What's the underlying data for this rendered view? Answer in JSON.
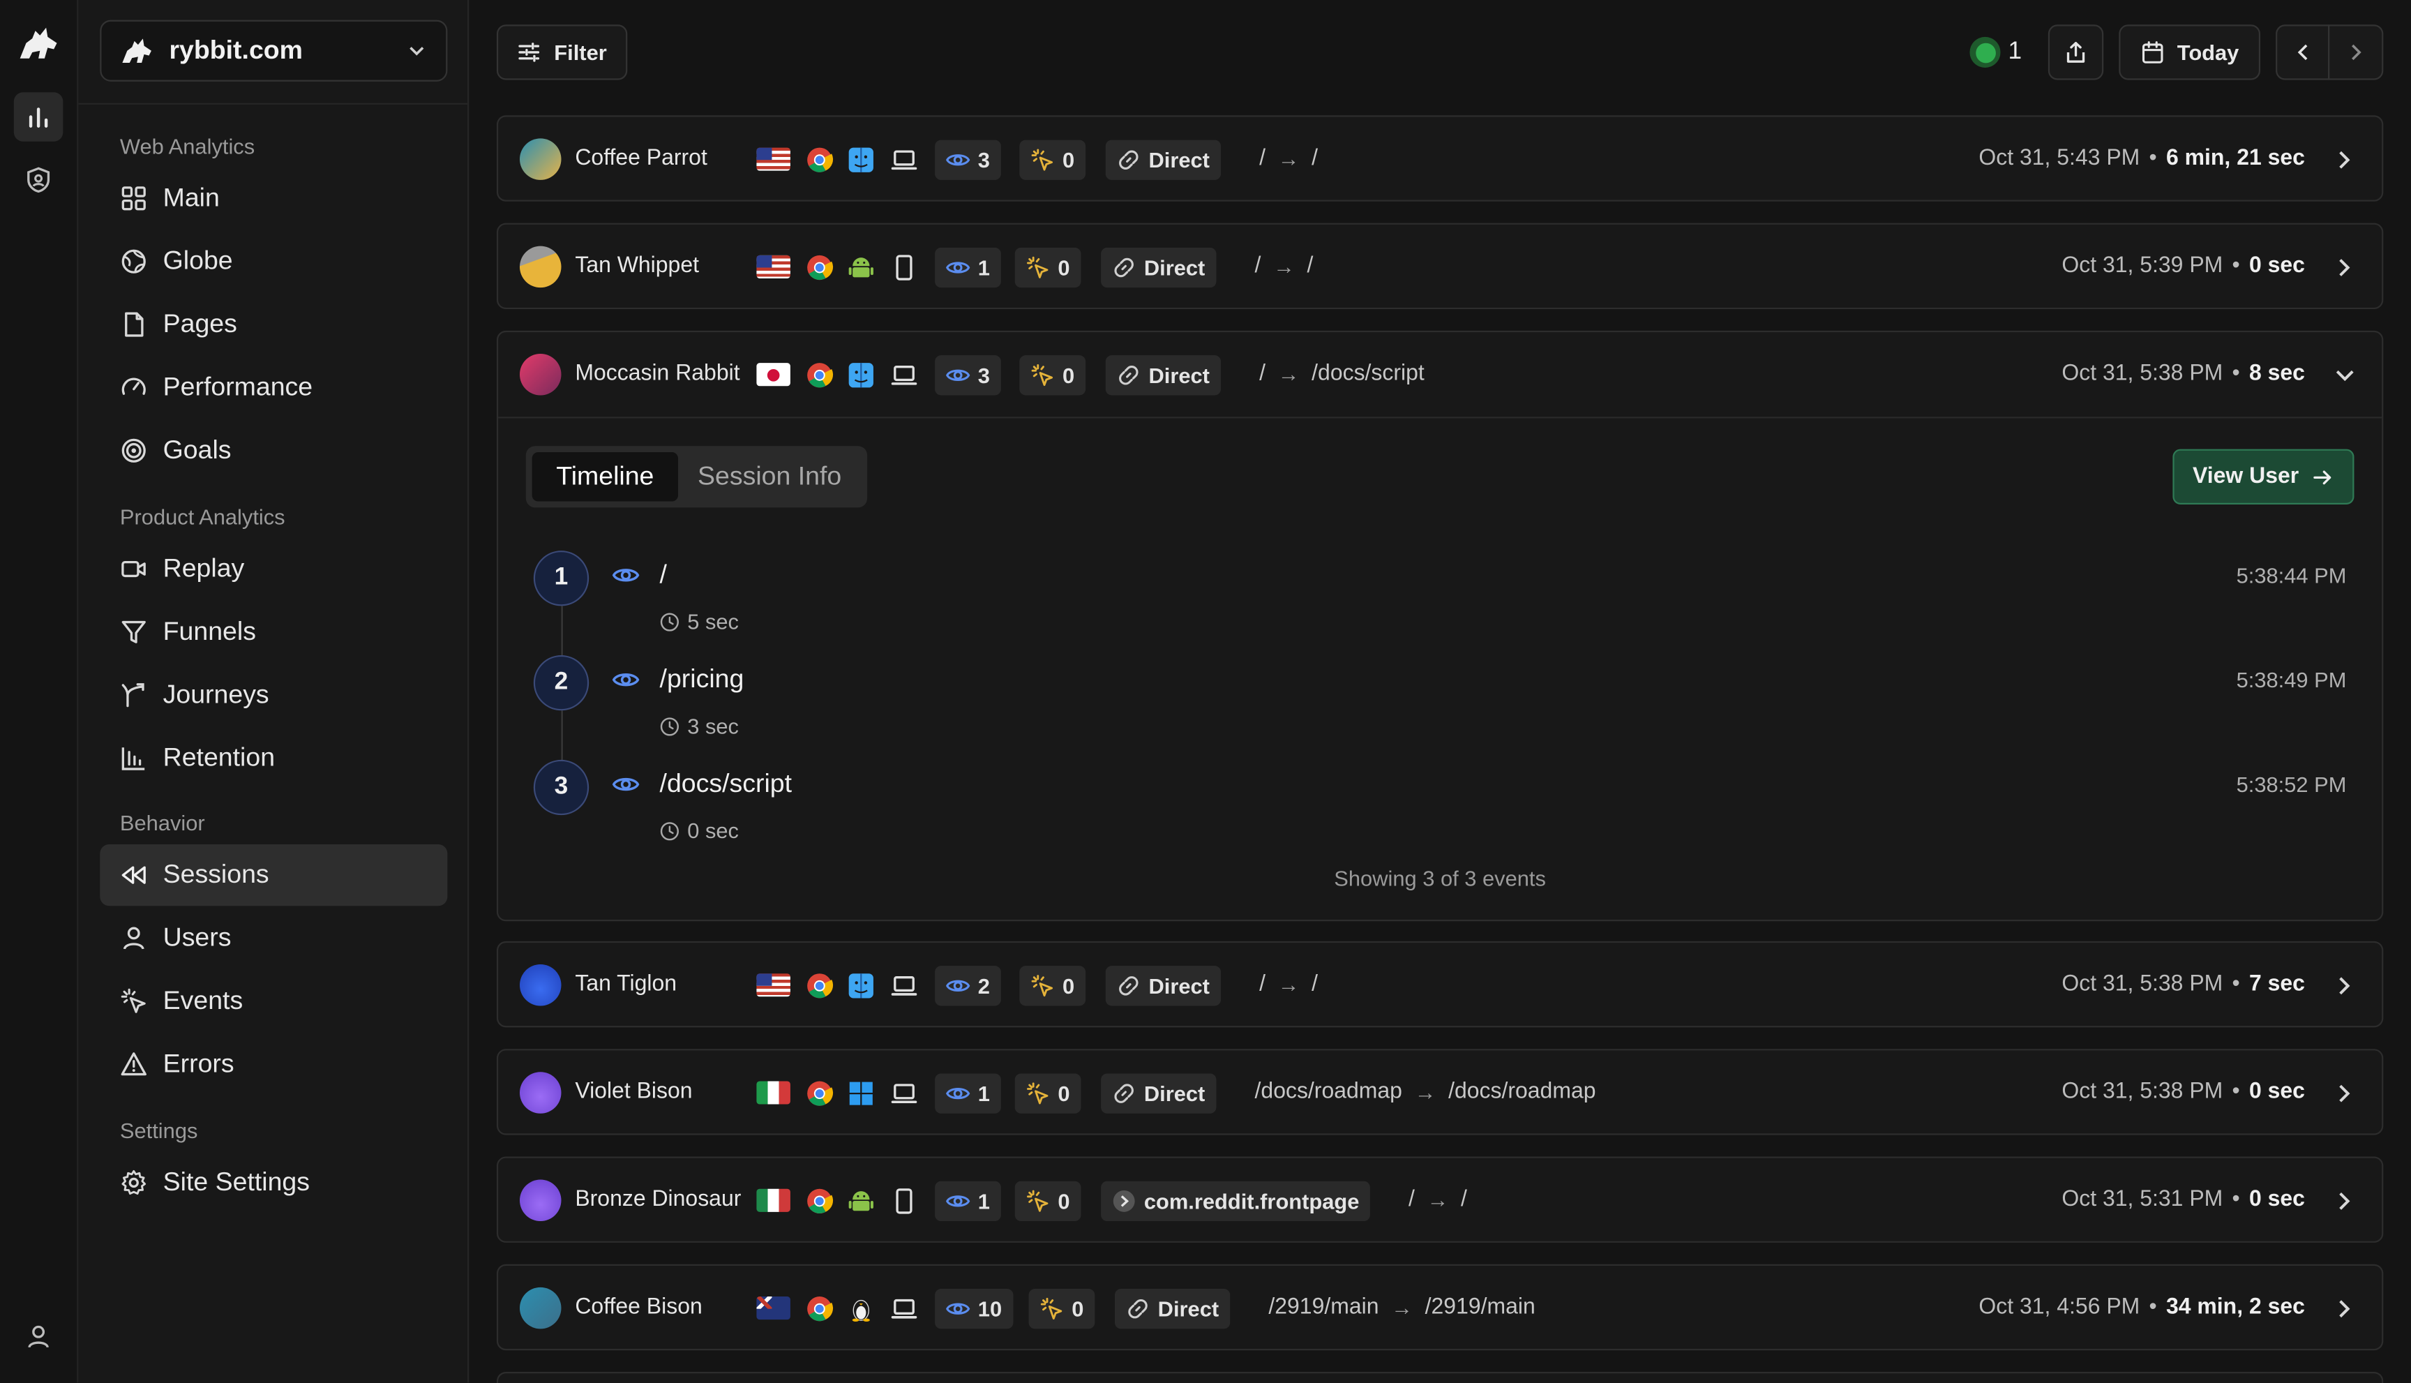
{
  "site": {
    "name": "rybbit.com"
  },
  "nav": {
    "sections": [
      {
        "label": "Web Analytics",
        "items": [
          "Main",
          "Globe",
          "Pages",
          "Performance",
          "Goals"
        ]
      },
      {
        "label": "Product Analytics",
        "items": [
          "Replay",
          "Funnels",
          "Journeys",
          "Retention"
        ]
      },
      {
        "label": "Behavior",
        "items": [
          "Sessions",
          "Users",
          "Events",
          "Errors"
        ]
      },
      {
        "label": "Settings",
        "items": [
          "Site Settings"
        ]
      }
    ],
    "active": "Sessions"
  },
  "toolbar": {
    "filter_label": "Filter",
    "live_count": "1",
    "date_label": "Today"
  },
  "colors": {
    "live": "#2fae4f",
    "accent_green": "#1c4a34",
    "pageview": "#5b8def",
    "event": "#e5b33a"
  },
  "sessions": [
    {
      "name": "Coffee Parrot",
      "country": "US",
      "browser": "Chrome",
      "os": "macOS",
      "device": "laptop",
      "pageviews": "3",
      "events": "0",
      "referrer": "Direct",
      "entry": "/",
      "exit": "/",
      "time": "Oct 31, 5:43 PM",
      "duration": "6 min, 21 sec"
    },
    {
      "name": "Tan Whippet",
      "country": "US",
      "browser": "Chrome",
      "os": "Android",
      "device": "mobile",
      "pageviews": "1",
      "events": "0",
      "referrer": "Direct",
      "entry": "/",
      "exit": "/",
      "time": "Oct 31, 5:39 PM",
      "duration": "0 sec"
    },
    {
      "name": "Moccasin Rabbit",
      "country": "JP",
      "browser": "Chrome",
      "os": "macOS",
      "device": "laptop",
      "pageviews": "3",
      "events": "0",
      "referrer": "Direct",
      "entry": "/",
      "exit": "/docs/script",
      "time": "Oct 31, 5:38 PM",
      "duration": "8 sec"
    },
    {
      "name": "Tan Tiglon",
      "country": "US",
      "browser": "Chrome",
      "os": "macOS",
      "device": "laptop",
      "pageviews": "2",
      "events": "0",
      "referrer": "Direct",
      "entry": "/",
      "exit": "/",
      "time": "Oct 31, 5:38 PM",
      "duration": "7 sec"
    },
    {
      "name": "Violet Bison",
      "country": "IT",
      "browser": "Chrome",
      "os": "Windows",
      "device": "laptop",
      "pageviews": "1",
      "events": "0",
      "referrer": "Direct",
      "entry": "/docs/roadmap",
      "exit": "/docs/roadmap",
      "time": "Oct 31, 5:38 PM",
      "duration": "0 sec"
    },
    {
      "name": "Bronze Dinosaur",
      "country": "MX",
      "browser": "Chrome",
      "os": "Android",
      "device": "mobile",
      "pageviews": "1",
      "events": "0",
      "referrer": "com.reddit.frontpage",
      "entry": "/",
      "exit": "/",
      "time": "Oct 31, 5:31 PM",
      "duration": "0 sec"
    },
    {
      "name": "Coffee Bison",
      "country": "AU",
      "browser": "Chrome",
      "os": "Linux",
      "device": "laptop",
      "pageviews": "10",
      "events": "0",
      "referrer": "Direct",
      "entry": "/2919/main",
      "exit": "/2919/main",
      "time": "Oct 31, 4:56 PM",
      "duration": "34 min, 2 sec"
    }
  ],
  "expanded": {
    "tabs": [
      "Timeline",
      "Session Info"
    ],
    "view_user_label": "View User",
    "events": [
      {
        "step": "1",
        "path": "/",
        "duration": "5 sec",
        "time": "5:38:44 PM"
      },
      {
        "step": "2",
        "path": "/pricing",
        "duration": "3 sec",
        "time": "5:38:49 PM"
      },
      {
        "step": "3",
        "path": "/docs/script",
        "duration": "0 sec",
        "time": "5:38:52 PM"
      }
    ],
    "showing": "Showing 3 of 3 events"
  }
}
